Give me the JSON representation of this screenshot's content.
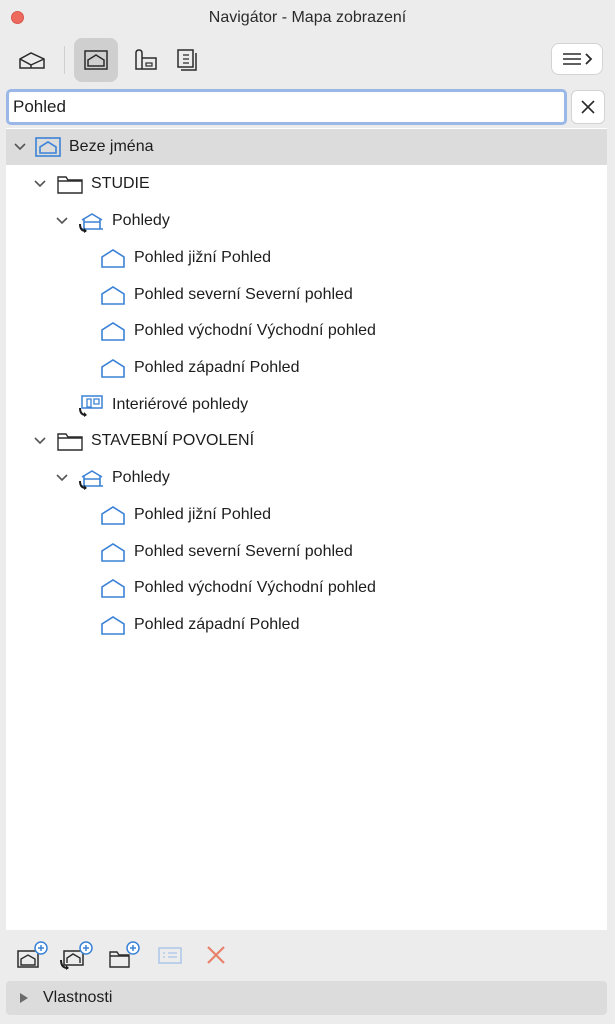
{
  "window": {
    "title": "Navigátor - Mapa zobrazení"
  },
  "search": {
    "value": "Pohled"
  },
  "tree": [
    {
      "label": "Beze jména",
      "icon": "project-icon",
      "level": 0,
      "expanded": true,
      "selected": true
    },
    {
      "label": "STUDIE",
      "icon": "folder-icon",
      "level": 1,
      "expanded": true
    },
    {
      "label": "Pohledy",
      "icon": "elevation-group-icon",
      "level": 2,
      "expanded": true
    },
    {
      "label": "Pohled jižní Pohled",
      "icon": "elevation-view-icon",
      "level": 3
    },
    {
      "label": "Pohled severní Severní pohled",
      "icon": "elevation-view-icon",
      "level": 3
    },
    {
      "label": "Pohled východní Východní pohled",
      "icon": "elevation-view-icon",
      "level": 3
    },
    {
      "label": "Pohled západní Pohled",
      "icon": "elevation-view-icon",
      "level": 3
    },
    {
      "label": "Interiérové pohledy",
      "icon": "interior-elevation-icon",
      "level": 2
    },
    {
      "label": "STAVEBNÍ POVOLENÍ",
      "icon": "folder-icon",
      "level": 1,
      "expanded": true
    },
    {
      "label": "Pohledy",
      "icon": "elevation-group-icon",
      "level": 2,
      "expanded": true
    },
    {
      "label": "Pohled jižní Pohled",
      "icon": "elevation-view-icon",
      "level": 3
    },
    {
      "label": "Pohled severní Severní pohled",
      "icon": "elevation-view-icon",
      "level": 3
    },
    {
      "label": "Pohled východní Východní pohled",
      "icon": "elevation-view-icon",
      "level": 3
    },
    {
      "label": "Pohled západní Pohled",
      "icon": "elevation-view-icon",
      "level": 3
    }
  ],
  "properties": {
    "label": "Vlastnosti"
  },
  "colors": {
    "accent": "#3b82d6",
    "delete": "#e8826a",
    "selection": "#dcdcdc"
  }
}
